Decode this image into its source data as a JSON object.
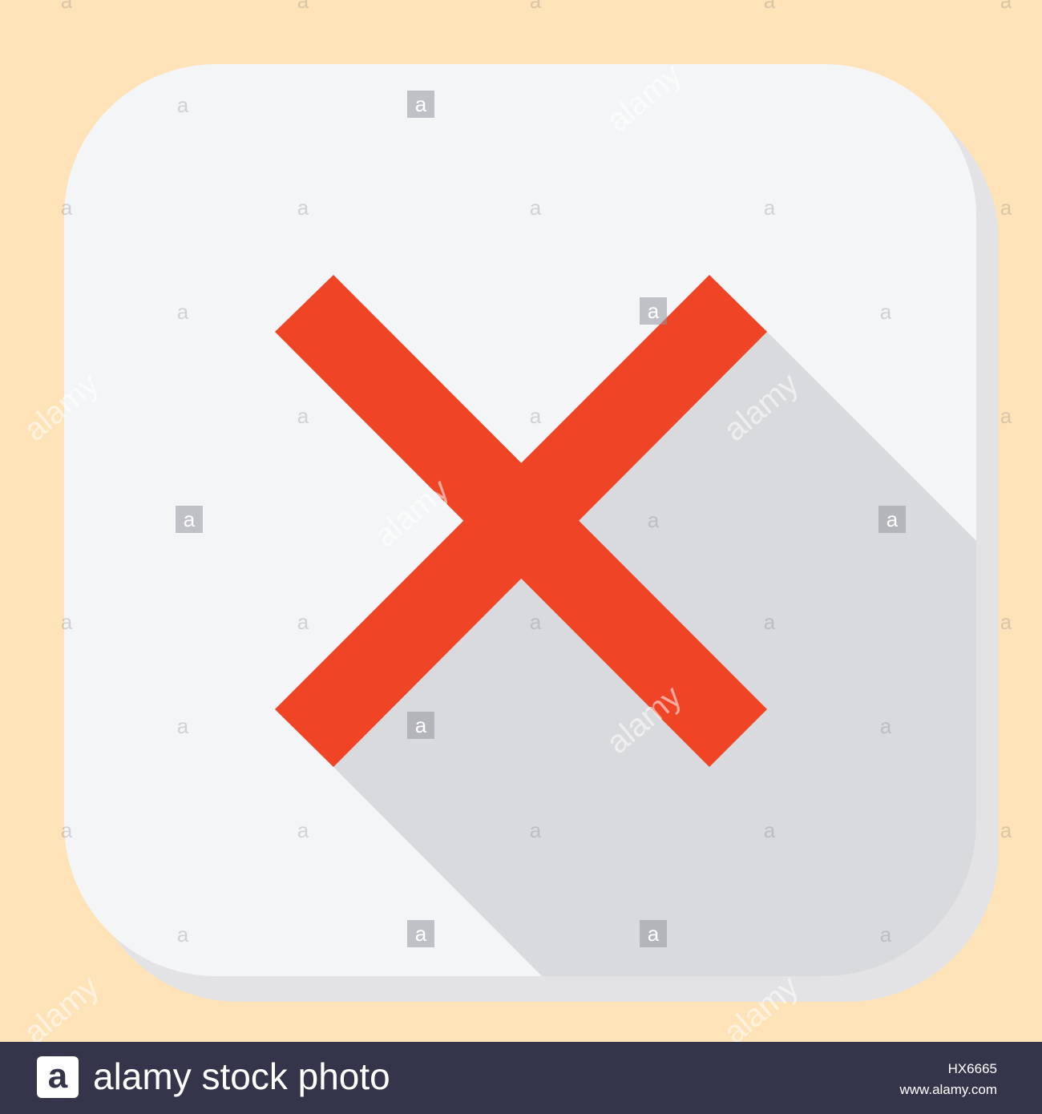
{
  "icon": {
    "name": "close-icon",
    "mark_color": "#ef4426",
    "tile_color": "#f4f5f7",
    "tile_shadow_color": "#e3e3e5",
    "long_shadow_color": "#d9dadd",
    "background_color": "#ffe3b8"
  },
  "watermark": {
    "word": "alamy",
    "letter": "a"
  },
  "footer": {
    "logo_letter": "a",
    "brand_text": "alamy stock photo",
    "image_id": "HX6665",
    "site_url": "www.alamy.com",
    "bar_color": "#34344a"
  }
}
